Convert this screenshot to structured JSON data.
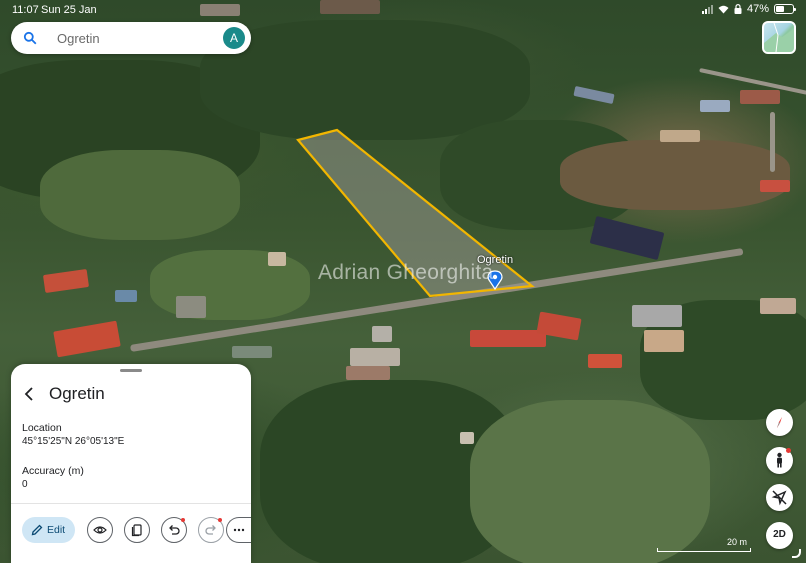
{
  "status_bar": {
    "time": "11:07",
    "date": "Sun 25 Jan",
    "battery": "47%",
    "battery_level": 0.47
  },
  "search": {
    "placeholder": "Ogretin",
    "avatar_letter": "A"
  },
  "map": {
    "marker_label": "Ogretin",
    "watermark": "Adrian Gheorghita",
    "polygon_color": "#f2b600",
    "marker_color": "#1a73e8"
  },
  "sheet": {
    "title": "Ogretin",
    "location_label": "Location",
    "location_value": "45°15'25\"N 26°05'13\"E",
    "accuracy_label": "Accuracy (m)",
    "accuracy_value": "0",
    "edit_label": "Edit",
    "action_icons": [
      "eye-icon",
      "duplicate-icon",
      "undo-icon",
      "redo-icon",
      "more-icon"
    ]
  },
  "controls": {
    "compass_icon": "compass-icon",
    "street_view_icon": "pegman-icon",
    "location_off_icon": "location-off-icon",
    "view_mode": "2D",
    "scale": "20 m"
  }
}
